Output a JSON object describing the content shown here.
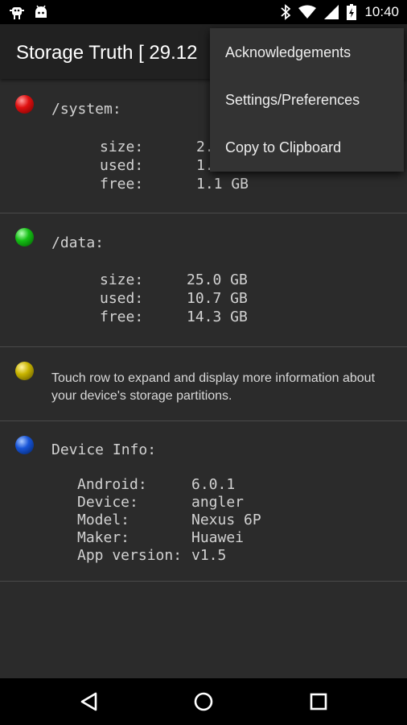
{
  "status_bar": {
    "time": "10:40",
    "left_icons": [
      "android-debug-icon",
      "android-robot-icon"
    ],
    "right_icons": [
      "bluetooth-icon",
      "wifi-icon",
      "signal-icon",
      "battery-icon"
    ]
  },
  "app_bar": {
    "title": "Storage Truth  [ 29.12"
  },
  "menu": {
    "items": [
      {
        "label": "Acknowledgements"
      },
      {
        "label": "Settings/Preferences"
      },
      {
        "label": "Copy to Clipboard"
      }
    ]
  },
  "partitions": [
    {
      "name": "/system:",
      "ball_color": "#e01010",
      "size": "2.",
      "used": "1.",
      "free": "1.1 GB"
    },
    {
      "name": "/data:",
      "ball_color": "#16c016",
      "size": "25.0 GB",
      "used": "10.7 GB",
      "free": "14.3 GB"
    }
  ],
  "labels": {
    "size": "size:",
    "used": "used:",
    "free": "free:"
  },
  "hint": {
    "ball_color": "#c8b400",
    "text": "Touch row to expand and display more information about your device's storage partitions."
  },
  "device_info": {
    "ball_color": "#1855d8",
    "heading": "Device Info:",
    "rows": [
      {
        "label": "Android:",
        "value": "6.0.1"
      },
      {
        "label": "Device:",
        "value": "angler"
      },
      {
        "label": "Model:",
        "value": "Nexus 6P"
      },
      {
        "label": "Maker:",
        "value": "Huawei"
      },
      {
        "label": "App version:",
        "value": "v1.5"
      }
    ]
  },
  "nav_bar": {
    "buttons": [
      "back-icon",
      "home-icon",
      "recents-icon"
    ]
  }
}
